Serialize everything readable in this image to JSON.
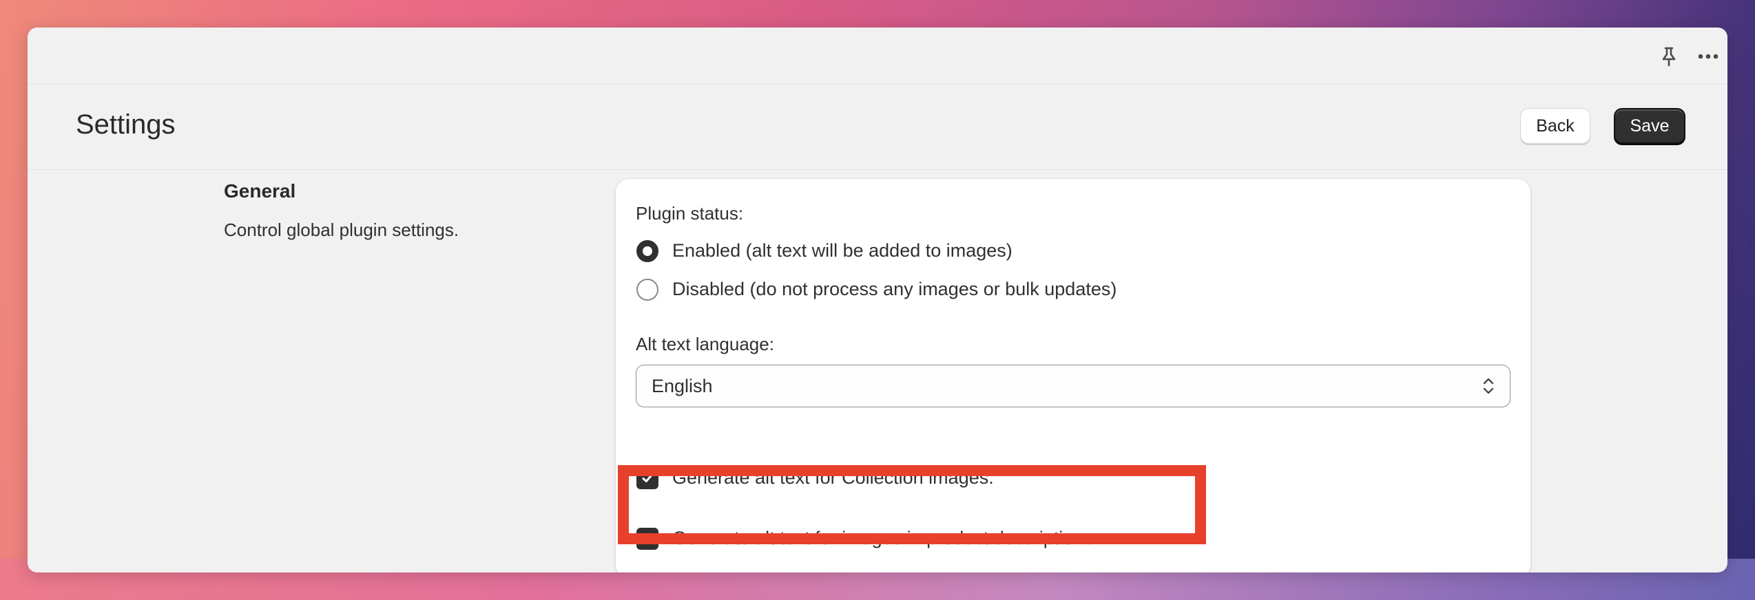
{
  "colors": {
    "window_bg": "#f1f1f1",
    "card_bg": "#ffffff",
    "primary_button": "#303030",
    "highlight": "#e8412b"
  },
  "topbar": {
    "icons": [
      "pin-icon",
      "more-horizontal-icon"
    ]
  },
  "header": {
    "title": "Settings",
    "back_label": "Back",
    "save_label": "Save"
  },
  "section": {
    "heading": "General",
    "description": "Control global plugin settings."
  },
  "card": {
    "plugin_status_label": "Plugin status:",
    "status_options": [
      {
        "label": "Enabled (alt text will be added to images)",
        "selected": true
      },
      {
        "label": "Disabled (do not process any images or bulk updates)",
        "selected": false
      }
    ],
    "language_label": "Alt text language:",
    "language_value": "English",
    "checkboxes": [
      {
        "label": "Generate alt text for Collection images.",
        "checked": true
      },
      {
        "label": "Generate alt text for images in product descriptions.",
        "checked": true
      }
    ]
  }
}
